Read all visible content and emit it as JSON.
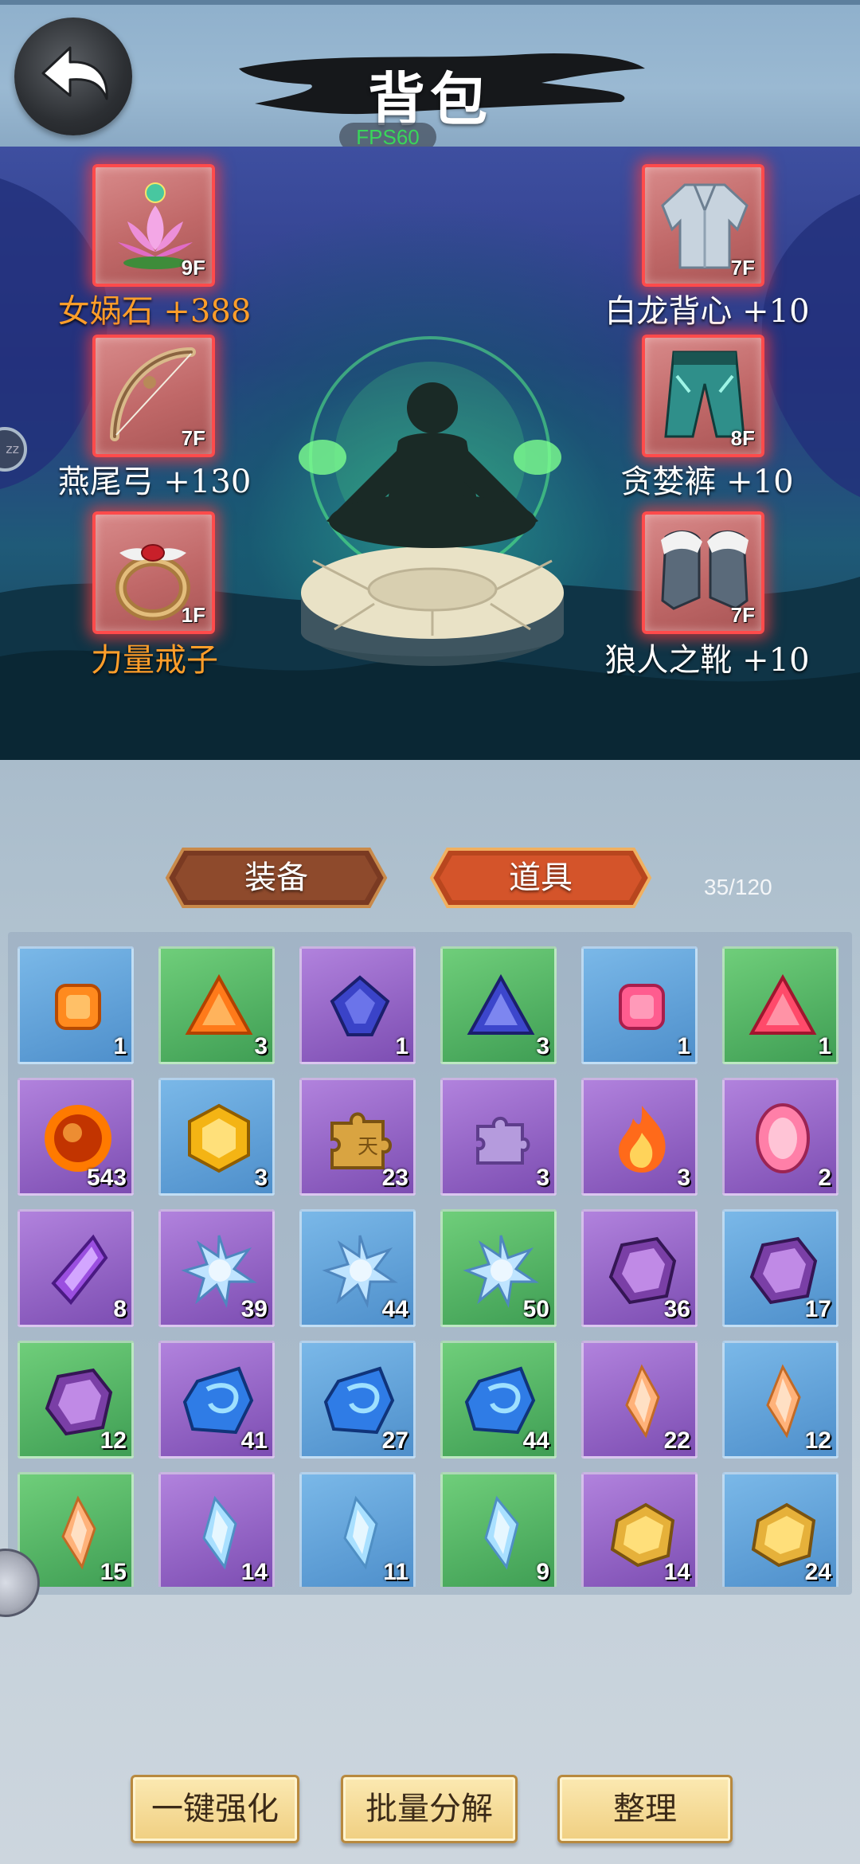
{
  "header": {
    "title": "背包",
    "fps": "FPS60"
  },
  "equipment": {
    "left": [
      {
        "name": "女娲石 +388",
        "floor": "9F",
        "icon": "lotus-icon",
        "color": "#ff9e2a"
      },
      {
        "name": "燕尾弓 +130",
        "floor": "7F",
        "icon": "bow-icon",
        "color": "#ffffff"
      },
      {
        "name": "力量戒子",
        "floor": "1F",
        "icon": "ring-icon",
        "color": "#ff9e2a"
      }
    ],
    "right": [
      {
        "name": "白龙背心 +10",
        "floor": "7F",
        "icon": "vest-icon",
        "color": "#ffffff"
      },
      {
        "name": "贪婪裤 +10",
        "floor": "8F",
        "icon": "pants-icon",
        "color": "#ffffff"
      },
      {
        "name": "狼人之靴 +10",
        "floor": "7F",
        "icon": "boots-icon",
        "color": "#ffffff"
      }
    ]
  },
  "tabs": {
    "equipment": "装备",
    "items": "道具",
    "active": "items"
  },
  "inventory_count": "35/120",
  "items": [
    {
      "bg": "blue",
      "icon": "orange-gem-icon",
      "qty": "1"
    },
    {
      "bg": "green",
      "icon": "orange-triangle-gem-icon",
      "qty": "3"
    },
    {
      "bg": "purple",
      "icon": "blue-gem-icon",
      "qty": "1"
    },
    {
      "bg": "green",
      "icon": "blue-triangle-gem-icon",
      "qty": "3"
    },
    {
      "bg": "blue",
      "icon": "pink-gem-icon",
      "qty": "1"
    },
    {
      "bg": "green",
      "icon": "red-triangle-gem-icon",
      "qty": "1"
    },
    {
      "bg": "purple",
      "icon": "fire-orb-icon",
      "qty": "543"
    },
    {
      "bg": "blue",
      "icon": "gold-hexagon-gem-icon",
      "qty": "3"
    },
    {
      "bg": "purple",
      "icon": "gold-puzzle-piece-icon",
      "qty": "23"
    },
    {
      "bg": "purple",
      "icon": "purple-puzzle-piece-icon",
      "qty": "3"
    },
    {
      "bg": "purple",
      "icon": "flame-icon",
      "qty": "3"
    },
    {
      "bg": "purple",
      "icon": "pink-oval-gem-icon",
      "qty": "2"
    },
    {
      "bg": "purple",
      "icon": "purple-crystal-icon",
      "qty": "8"
    },
    {
      "bg": "purple",
      "icon": "ice-crystal-cluster-icon",
      "qty": "39"
    },
    {
      "bg": "blue",
      "icon": "ice-crystal-cluster-icon",
      "qty": "44"
    },
    {
      "bg": "green",
      "icon": "ice-crystal-cluster-icon",
      "qty": "50"
    },
    {
      "bg": "purple",
      "icon": "amethyst-ore-icon",
      "qty": "36"
    },
    {
      "bg": "blue",
      "icon": "amethyst-ore-icon",
      "qty": "17"
    },
    {
      "bg": "green",
      "icon": "amethyst-ore-icon",
      "qty": "12"
    },
    {
      "bg": "purple",
      "icon": "blue-stone-icon",
      "qty": "41"
    },
    {
      "bg": "blue",
      "icon": "blue-stone-icon",
      "qty": "27"
    },
    {
      "bg": "green",
      "icon": "blue-stone-icon",
      "qty": "44"
    },
    {
      "bg": "purple",
      "icon": "orange-shard-icon",
      "qty": "22"
    },
    {
      "bg": "blue",
      "icon": "orange-shard-icon",
      "qty": "12"
    },
    {
      "bg": "green",
      "icon": "orange-shard-icon",
      "qty": "15"
    },
    {
      "bg": "purple",
      "icon": "light-blue-shard-icon",
      "qty": "14"
    },
    {
      "bg": "blue",
      "icon": "light-blue-shard-icon",
      "qty": "11"
    },
    {
      "bg": "green",
      "icon": "light-blue-shard-icon",
      "qty": "9"
    },
    {
      "bg": "purple",
      "icon": "gold-nugget-icon",
      "qty": "14"
    },
    {
      "bg": "blue",
      "icon": "gold-nugget-icon",
      "qty": "24"
    }
  ],
  "buttons": {
    "auto_enhance": "一键强化",
    "batch_decompose": "批量分解",
    "sort": "整理"
  },
  "colors": {
    "blue_cell": "#4e8fcb",
    "green_cell": "#3f9e54",
    "purple_cell": "#7c4db2",
    "slot_glow": "#ff4b4b",
    "active_tab": "#d4542a"
  }
}
